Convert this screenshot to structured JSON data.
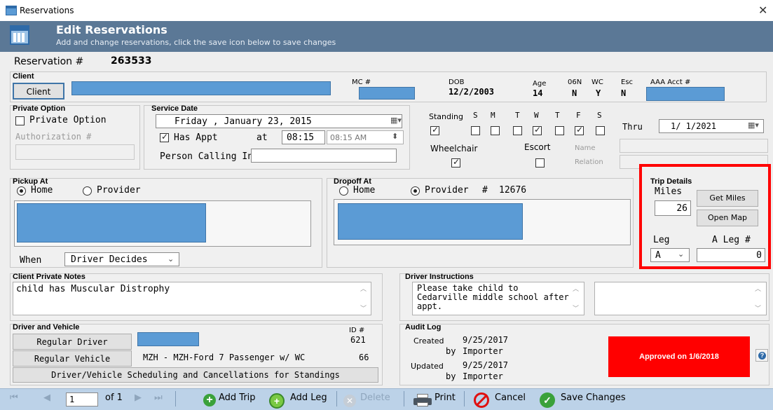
{
  "window": {
    "title": "Reservations"
  },
  "header": {
    "title": "Edit Reservations",
    "subtitle": "Add and change reservations, click the save icon below to save changes"
  },
  "reservation": {
    "label": "Reservation #",
    "number": "263533"
  },
  "client": {
    "section": "Client",
    "button": "Client",
    "mc_label": "MC #",
    "dob_label": "DOB",
    "dob": "12/2/2003",
    "age_label": "Age",
    "age": "14",
    "o6n_label": "06N",
    "o6n": "N",
    "wc_label": "WC",
    "wc": "Y",
    "esc_label": "Esc",
    "esc": "N",
    "aaa_label": "AAA Acct #"
  },
  "private_option": {
    "section": "Private Option",
    "checkbox": "Private Option",
    "auth_label": "Authorization #"
  },
  "service_date": {
    "section": "Service Date",
    "date": "Friday   ,  January  23, 2015",
    "has_appt": "Has Appt",
    "at": "at",
    "time": "08:15",
    "time2": "08:15 AM",
    "person_calling": "Person Calling In"
  },
  "standing": {
    "label": "Standing",
    "days": [
      "S",
      "M",
      "T",
      "W",
      "T",
      "F",
      "S"
    ],
    "thru_label": "Thru",
    "thru": "1/ 1/2021",
    "wheelchair": "Wheelchair",
    "escort": "Escort",
    "name": "Name",
    "relation": "Relation"
  },
  "pickup": {
    "section": "Pickup At",
    "home": "Home",
    "provider": "Provider",
    "when_label": "When",
    "when_value": "Driver Decides"
  },
  "dropoff": {
    "section": "Dropoff At",
    "home": "Home",
    "provider": "Provider",
    "hash": "#",
    "provider_no": "12676"
  },
  "trip_details": {
    "section": "Trip Details",
    "miles_label": "Miles",
    "miles": "26",
    "get_miles": "Get Miles",
    "open_map": "Open Map",
    "leg_label": "Leg",
    "leg": "A",
    "aleg_label": "A Leg #",
    "aleg": "0"
  },
  "notes": {
    "section": "Client Private Notes",
    "text": "child has Muscular Distrophy"
  },
  "driver_instr": {
    "section": "Driver Instructions",
    "line1": "Please take child to",
    "line2": "Cedarville middle school after",
    "line3": "appt."
  },
  "driver_vehicle": {
    "section": "Driver and Vehicle",
    "id_label": "ID #",
    "regular_driver": "Regular Driver",
    "driver_id": "621",
    "regular_vehicle": "Regular Vehicle",
    "vehicle_desc": "MZH -  MZH-Ford 7 Passenger w/ WC",
    "vehicle_id": "66",
    "scheduling": "Driver/Vehicle Scheduling and Cancellations for Standings"
  },
  "audit": {
    "section": "Audit Log",
    "created": "Created",
    "created_date": "9/25/2017",
    "by": "by",
    "created_by": "Importer",
    "updated": "Updated",
    "updated_date": "9/25/2017",
    "updated_by": "Importer"
  },
  "status": {
    "text": "Approved on 1/6/2018",
    "color": "#ff0000"
  },
  "toolbar": {
    "page": "1",
    "of": "of 1",
    "add_trip": "Add Trip",
    "add_leg": "Add Leg",
    "delete": "Delete",
    "print": "Print",
    "cancel": "Cancel",
    "save": "Save Changes"
  }
}
